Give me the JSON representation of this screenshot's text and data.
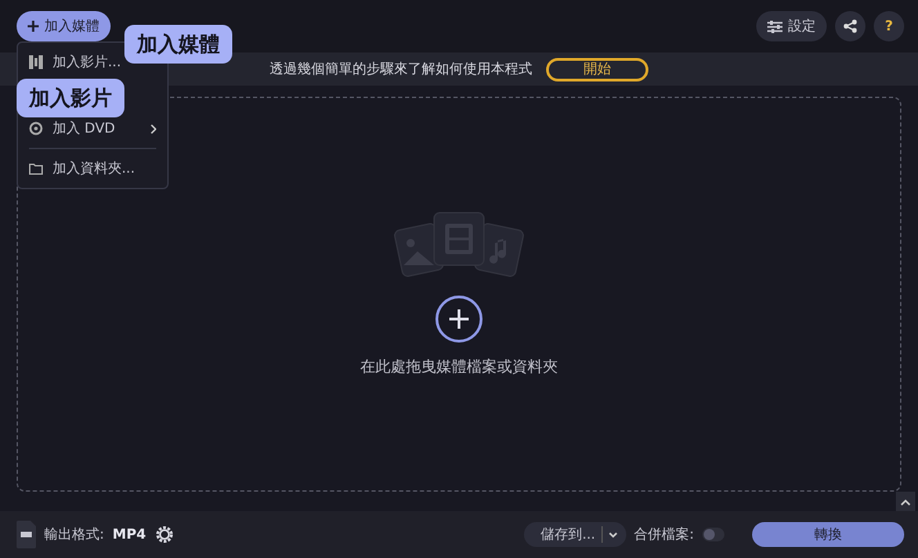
{
  "toolbar": {
    "add_media_button": "加入媒體",
    "settings_button": "設定",
    "help_button": "?"
  },
  "add_menu": [
    {
      "kind": "item",
      "label": "加入影片..."
    },
    {
      "kind": "covered"
    },
    {
      "kind": "submenu",
      "label": "加入 DVD"
    },
    {
      "kind": "divider"
    },
    {
      "kind": "item",
      "label": "加入資料夾..."
    }
  ],
  "callouts": [
    "加入媒體",
    "加入影片"
  ],
  "info_bar": {
    "text": "透過幾個簡單的步驟來了解如何使用本程式",
    "button": "開始"
  },
  "drop_zone": {
    "hint": "在此處拖曳媒體檔案或資料夾"
  },
  "bottom_bar": {
    "format_label": "輸出格式:",
    "format_value": "MP4",
    "save_to": "儲存到...",
    "merge_label": "合併檔案:",
    "merge_on": false,
    "convert_button": "轉換"
  }
}
